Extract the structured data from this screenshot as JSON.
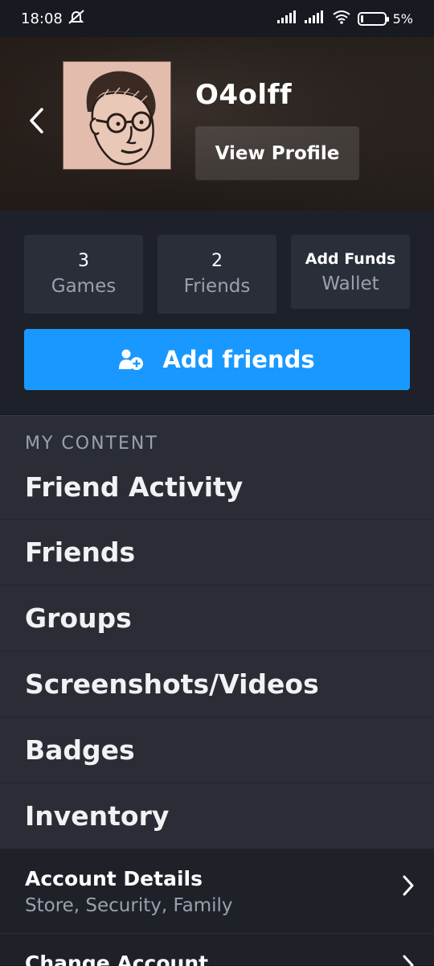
{
  "status_bar": {
    "time": "18:08",
    "battery": "5%"
  },
  "profile": {
    "username": "O4olff",
    "view_profile_label": "View Profile"
  },
  "stats": [
    {
      "value": "3",
      "label": "Games"
    },
    {
      "value": "2",
      "label": "Friends"
    },
    {
      "value": "Add Funds",
      "label": "Wallet"
    }
  ],
  "add_friends_label": "Add friends",
  "my_content": {
    "title": "MY CONTENT",
    "items": [
      "Friend Activity",
      "Friends",
      "Groups",
      "Screenshots/Videos",
      "Badges",
      "Inventory"
    ]
  },
  "account": {
    "details_title": "Account Details",
    "details_sub": "Store, Security, Family",
    "change_title": "Change Account"
  },
  "colors": {
    "accent": "#1999ff",
    "background": "#181a21",
    "panel": "#2a2d35"
  }
}
